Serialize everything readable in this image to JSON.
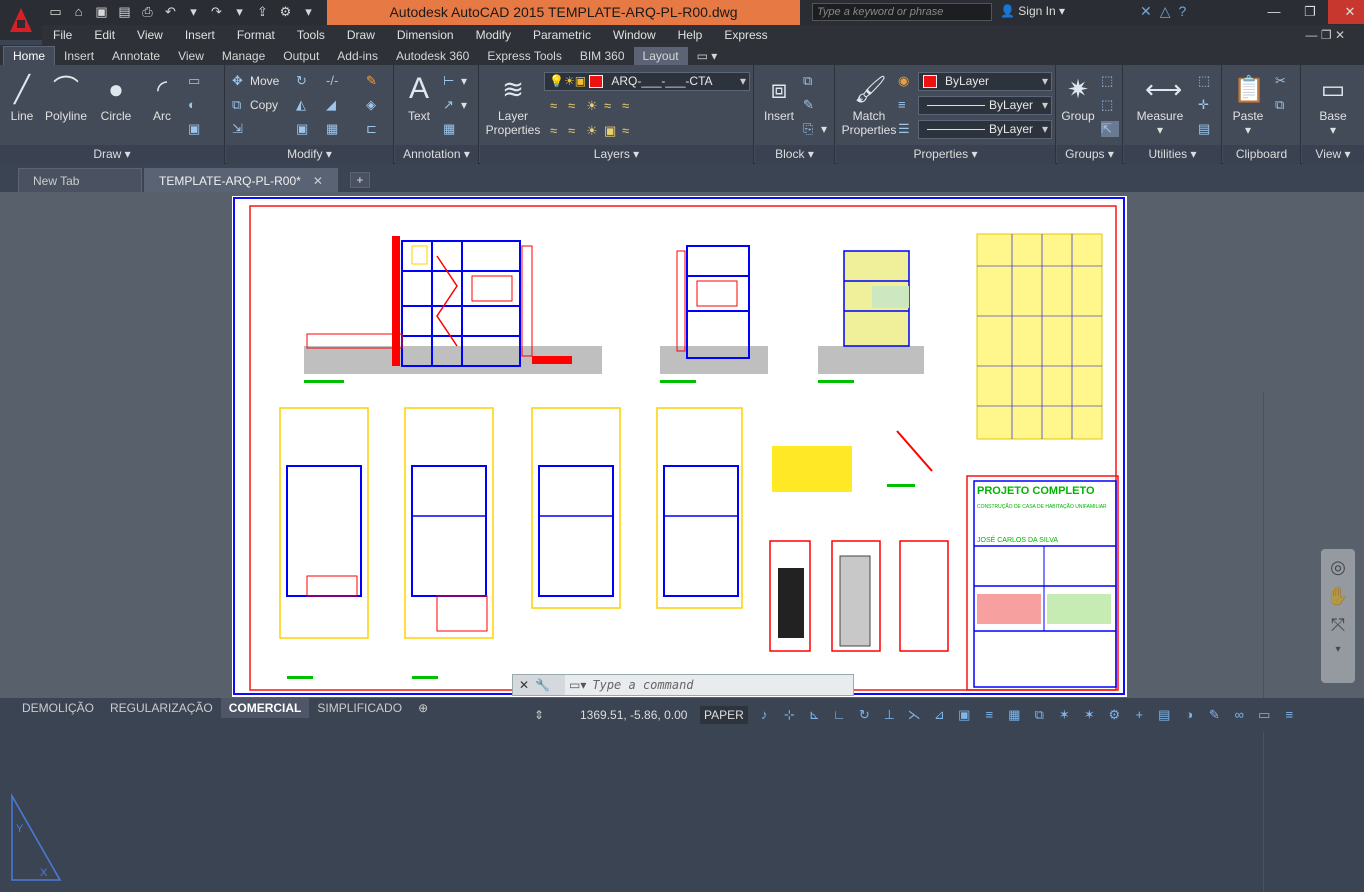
{
  "titlebar": {
    "title": "Autodesk AutoCAD 2015    TEMPLATE-ARQ-PL-R00.dwg",
    "search_placeholder": "Type a keyword or phrase",
    "sign_in": "Sign In",
    "accent_color": "#e77a44"
  },
  "menu": [
    "File",
    "Edit",
    "View",
    "Insert",
    "Format",
    "Tools",
    "Draw",
    "Dimension",
    "Modify",
    "Parametric",
    "Window",
    "Help",
    "Express"
  ],
  "ribbon_tabs": [
    "Home",
    "Insert",
    "Annotate",
    "View",
    "Manage",
    "Output",
    "Add-ins",
    "Autodesk 360",
    "Express Tools",
    "BIM 360",
    "Layout"
  ],
  "ribbon": {
    "draw": {
      "title": "Draw",
      "line": "Line",
      "polyline": "Polyline",
      "circle": "Circle",
      "arc": "Arc"
    },
    "modify": {
      "title": "Modify",
      "move": "Move",
      "copy": "Copy"
    },
    "annotation": {
      "title": "Annotation",
      "text": "Text"
    },
    "layers": {
      "title": "Layers",
      "layer_properties_1": "Layer",
      "layer_properties_2": "Properties",
      "current_layer": "ARQ-___-___-CTA"
    },
    "block": {
      "title": "Block",
      "insert": "Insert"
    },
    "properties": {
      "title": "Properties",
      "match_1": "Match",
      "match_2": "Properties",
      "color": "ByLayer",
      "linetype": "ByLayer",
      "lineweight": "ByLayer"
    },
    "groups": {
      "title": "Groups",
      "group": "Group"
    },
    "utilities": {
      "title": "Utilities",
      "measure": "Measure"
    },
    "clipboard": {
      "title": "Clipboard",
      "paste": "Paste"
    },
    "view": {
      "title": "View",
      "base": "Base"
    }
  },
  "doc_tabs": {
    "new_tab": "New Tab",
    "current": "TEMPLATE-ARQ-PL-R00*"
  },
  "drawing": {
    "sheet_title": "PROJETO COMPLETO",
    "subtitle": "CONSTRUÇÃO DE CASA DE HABITAÇÃO UNIFAMILIAR",
    "owner": "JOSÉ CARLOS DA SILVA"
  },
  "command_placeholder": "Type a command",
  "layout_tabs": [
    "DEMOLIÇÃO",
    "REGULARIZAÇÃO",
    "COMERCIAL",
    "SIMPLIFICADO"
  ],
  "status": {
    "coords": "1369.51, -5.86, 0.00",
    "space": "PAPER"
  }
}
